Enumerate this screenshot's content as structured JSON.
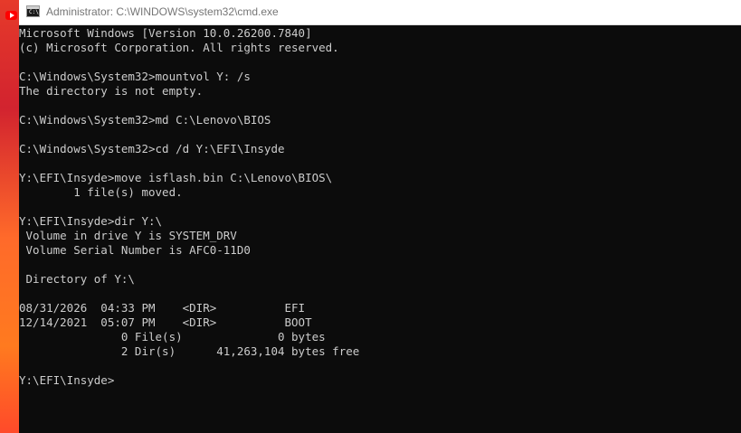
{
  "window": {
    "title": "Administrator: C:\\WINDOWS\\system32\\cmd.exe",
    "icon": "cmd-console-icon"
  },
  "console": {
    "lines": [
      "Microsoft Windows [Version 10.0.26200.7840]",
      "(c) Microsoft Corporation. All rights reserved.",
      "",
      "C:\\Windows\\System32>mountvol Y: /s",
      "The directory is not empty.",
      "",
      "C:\\Windows\\System32>md C:\\Lenovo\\BIOS",
      "",
      "C:\\Windows\\System32>cd /d Y:\\EFI\\Insyde",
      "",
      "Y:\\EFI\\Insyde>move isflash.bin C:\\Lenovo\\BIOS\\",
      "        1 file(s) moved.",
      "",
      "Y:\\EFI\\Insyde>dir Y:\\",
      " Volume in drive Y is SYSTEM_DRV",
      " Volume Serial Number is AFC0-11D0",
      "",
      " Directory of Y:\\",
      "",
      "08/31/2026  04:33 PM    <DIR>          EFI",
      "12/14/2021  05:07 PM    <DIR>          BOOT",
      "               0 File(s)              0 bytes",
      "               2 Dir(s)      41,263,104 bytes free",
      "",
      "Y:\\EFI\\Insyde>"
    ]
  },
  "colors": {
    "console_bg": "#0c0c0c",
    "console_fg": "#cccccc",
    "titlebar_bg": "#ffffff",
    "title_fg": "#767676",
    "wallpaper_accent": "#ff5a2e"
  }
}
